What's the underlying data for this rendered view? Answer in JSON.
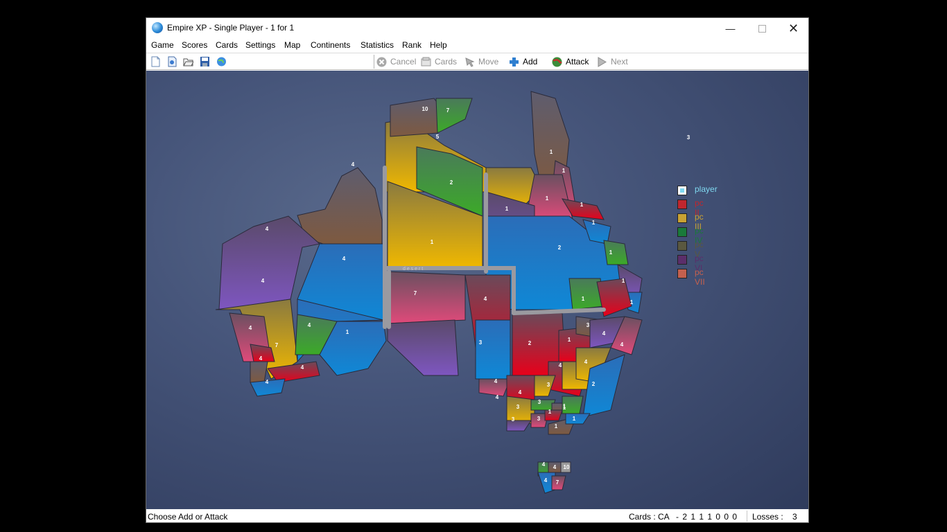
{
  "window": {
    "title": "Empire XP - Single Player - 1 for 1"
  },
  "menu": [
    "Game",
    "Scores",
    "Cards",
    "Settings",
    "Map",
    "Continents",
    "Statistics",
    "Rank",
    "Help"
  ],
  "toolbar": {
    "cancel": "Cancel",
    "cards": "Cards",
    "move": "Move",
    "add": "Add",
    "attack": "Attack",
    "next": "Next"
  },
  "map": {
    "label": "d e s e r t",
    "territories": [
      "10",
      "7",
      "5",
      "4",
      "2",
      "1",
      "1",
      "1",
      "1",
      "1",
      "1",
      "4",
      "4",
      "1",
      "2",
      "1",
      "1",
      "4",
      "1",
      "1",
      "4",
      "7",
      "4",
      "4",
      "1",
      "7",
      "4",
      "3",
      "2",
      "1",
      "3",
      "4",
      "4",
      "4",
      "4",
      "4",
      "4",
      "2",
      "4",
      "4",
      "3",
      "4",
      "3",
      "3",
      "1",
      "3",
      "3",
      "1",
      "1",
      "1",
      "1",
      "3",
      "4",
      "4",
      "10",
      "4",
      "7"
    ]
  },
  "legend": [
    {
      "label": "player",
      "color": "#7fd8f0"
    },
    {
      "label": "pc II",
      "color": "#c0262e"
    },
    {
      "label": "pc III",
      "color": "#c9a233"
    },
    {
      "label": "pc IV",
      "color": "#1a7a3a"
    },
    {
      "label": "pc V",
      "color": "#5a5840"
    },
    {
      "label": "pc VI",
      "color": "#5b2e6a"
    },
    {
      "label": "pc VII",
      "color": "#c4604e"
    }
  ],
  "status": {
    "message": "Choose Add or Attack",
    "cards_label": "Cards : CA",
    "cards_value": "- 2 1 1 1 0 0 0",
    "losses_label": "Losses :",
    "losses_value": "3"
  }
}
